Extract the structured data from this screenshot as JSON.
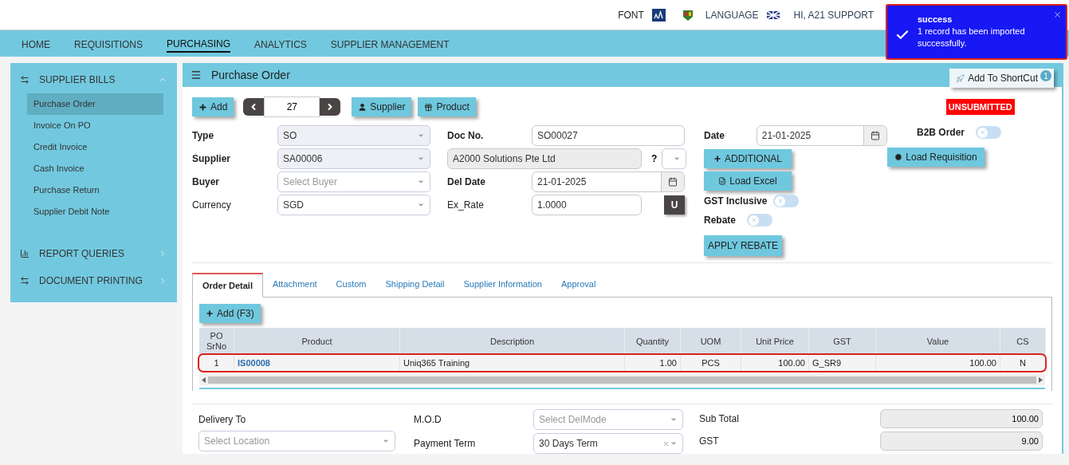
{
  "header": {
    "font_label": "FONT",
    "language_label": "LANGUAGE",
    "user": "HI, A21 SUPPORT"
  },
  "toast": {
    "title": "success",
    "message": "1 record has been imported successfully."
  },
  "nav": [
    {
      "label": "HOME",
      "selected": false
    },
    {
      "label": "REQUISITIONS",
      "selected": false
    },
    {
      "label": "PURCHASING",
      "selected": true
    },
    {
      "label": "ANALYTICS",
      "selected": false
    },
    {
      "label": "SUPPLIER MANAGEMENT",
      "selected": false
    }
  ],
  "sidebar": [
    {
      "title": "SUPPLIER BILLS",
      "kind": "swap",
      "expanded": true,
      "items": [
        {
          "label": "Purchase Order",
          "selected": true
        },
        {
          "label": "Invoice On PO",
          "selected": false
        },
        {
          "label": "Credit Invoice",
          "selected": false
        },
        {
          "label": "Cash Invoice",
          "selected": false
        },
        {
          "label": "Purchase Return",
          "selected": false
        },
        {
          "label": "Supplier Debit Note",
          "selected": false
        }
      ]
    },
    {
      "title": "REPORT QUERIES",
      "kind": "chart",
      "expanded": false
    },
    {
      "title": "DOCUMENT PRINTING",
      "kind": "swap",
      "expanded": false
    }
  ],
  "panel": {
    "title": "Purchase Order",
    "shortcut": "Add To ShortCut",
    "shortcut_count": "1"
  },
  "toolbar": {
    "add": "Add",
    "record": "27",
    "supplier": "Supplier",
    "product": "Product",
    "status": "UNSUBMITTED"
  },
  "form": {
    "type": {
      "label": "Type",
      "value": "SO"
    },
    "supplier": {
      "label": "Supplier",
      "value": "SA00006"
    },
    "buyer": {
      "label": "Buyer",
      "placeholder": "Select Buyer"
    },
    "currency": {
      "label": "Currency",
      "value": "SGD"
    },
    "doc_no": {
      "label": "Doc No.",
      "value": "SO00027"
    },
    "supplier_name": {
      "value": "A2000 Solutions Pte Ltd"
    },
    "question": "?",
    "del_date": {
      "label": "Del Date",
      "value": "21-01-2025"
    },
    "ex_rate": {
      "label": "Ex_Rate",
      "value": "1.0000"
    },
    "u_button": "U",
    "date": {
      "label": "Date",
      "value": "21-01-2025"
    },
    "additional": "ADDITIONAL",
    "load_excel": "Load Excel",
    "gst_inclusive": {
      "label": "GST Inclusive",
      "on": false
    },
    "rebate": {
      "label": "Rebate",
      "on": false
    },
    "apply_rebate": "APPLY REBATE",
    "b2b_order": {
      "label": "B2B Order",
      "on": false
    },
    "load_requisition": "Load Requisition"
  },
  "tabs": [
    {
      "label": "Order Detail",
      "selected": true
    },
    {
      "label": "Attachment",
      "selected": false
    },
    {
      "label": "Custom",
      "selected": false
    },
    {
      "label": "Shipping Detail",
      "selected": false
    },
    {
      "label": "Supplier Information",
      "selected": false
    },
    {
      "label": "Approval",
      "selected": false
    }
  ],
  "table": {
    "add": "Add (F3)",
    "columns": [
      "PO SrNo",
      "Product",
      "Description",
      "Quantity",
      "UOM",
      "Unit Price",
      "GST",
      "Value",
      "CS"
    ],
    "rows": [
      {
        "selected": true,
        "cells": [
          "1",
          "IS00008",
          "Uniq365 Training",
          "1.00",
          "PCS",
          "100.00",
          "G_SR9",
          "100.00",
          "N"
        ]
      }
    ]
  },
  "footer": {
    "delivery_to": {
      "label": "Delivery To",
      "placeholder": "Select Location"
    },
    "mod": {
      "label": "M.O.D",
      "placeholder": "Select DelMode"
    },
    "payment_term": {
      "label": "Payment Term",
      "value": "30 Days Term"
    },
    "sub_total": {
      "label": "Sub Total",
      "value": "100.00"
    },
    "gst": {
      "label": "GST",
      "value": "9.00"
    }
  }
}
